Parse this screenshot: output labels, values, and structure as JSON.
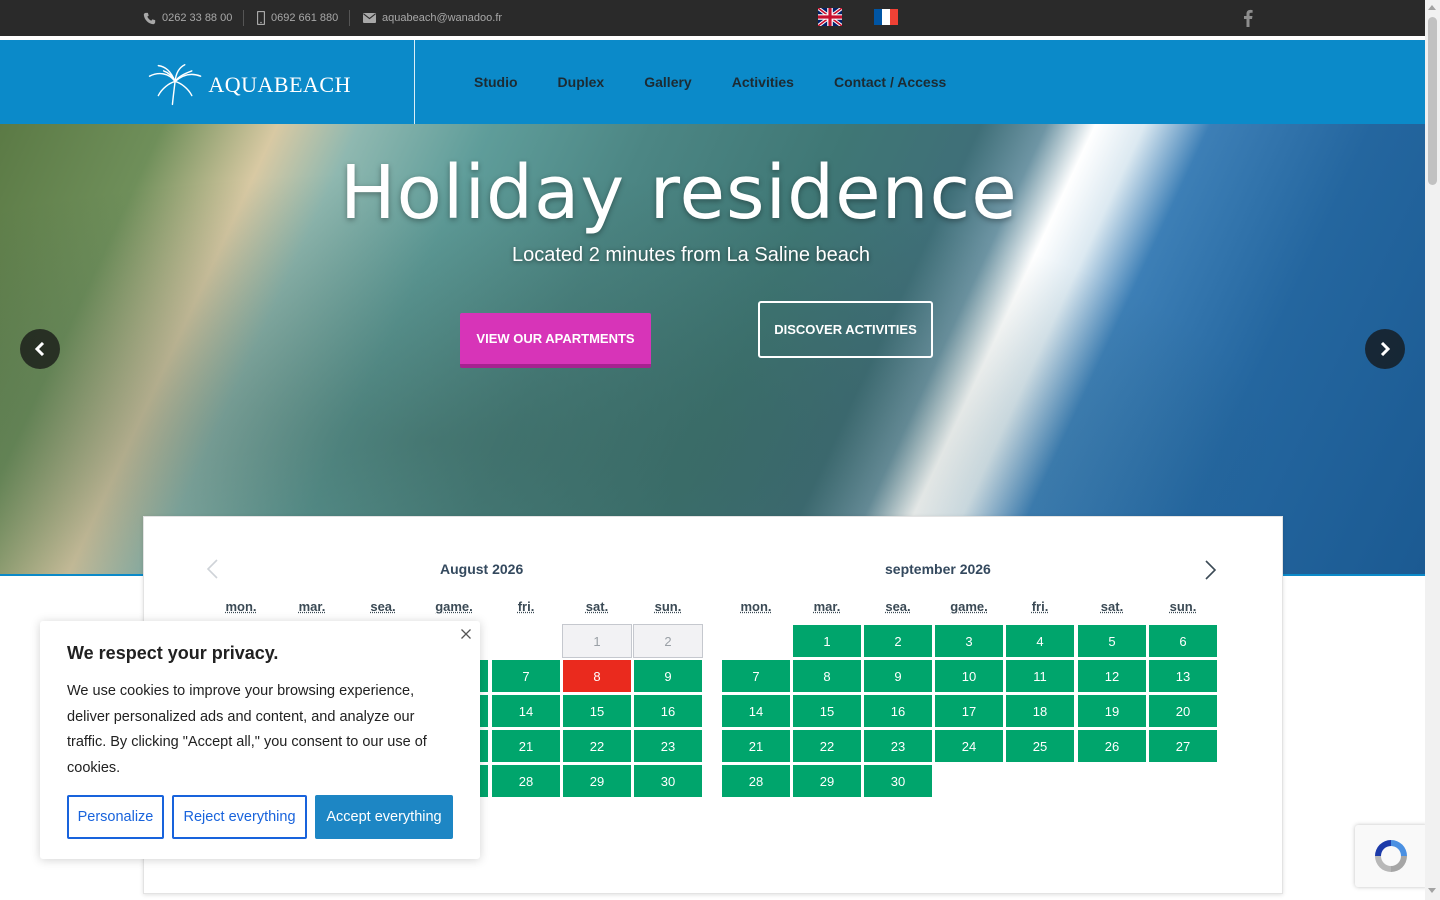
{
  "topbar": {
    "phone": "0262 33 88 00",
    "mobile": "0692 661 880",
    "email": "aquabeach@wanadoo.fr",
    "icons": [
      "phone-icon",
      "mobile-icon",
      "envelope-icon",
      "facebook-icon"
    ],
    "flags": [
      "uk-flag",
      "france-flag"
    ]
  },
  "header": {
    "logo_text": "AQUABEACH",
    "nav": [
      "Studio",
      "Duplex",
      "Gallery",
      "Activities",
      "Contact / Access"
    ]
  },
  "hero": {
    "title": "Holiday residence",
    "subtitle": "Located 2 minutes from La Saline beach",
    "btn_apartments": "VIEW OUR APARTMENTS",
    "btn_activities": "DISCOVER ACTIVITIES"
  },
  "calendar": {
    "months": [
      {
        "title": "August  2026",
        "days_of_week": [
          "mon.",
          "mar.",
          "sea.",
          "game.",
          "fri.",
          "sat.",
          "sun."
        ],
        "past_days": [
          "1",
          "2"
        ],
        "booked_days": [
          "8"
        ],
        "visible_days": [
          "7",
          "9",
          "14",
          "15",
          "16",
          "21",
          "22",
          "23",
          "28",
          "29",
          "30"
        ]
      },
      {
        "title": "september  2026",
        "days_of_week": [
          "mon.",
          "mar.",
          "sea.",
          "game.",
          "fri.",
          "sat.",
          "sun."
        ],
        "days": [
          "1",
          "2",
          "3",
          "4",
          "5",
          "6",
          "7",
          "8",
          "9",
          "10",
          "11",
          "12",
          "13",
          "14",
          "15",
          "16",
          "17",
          "18",
          "19",
          "20",
          "21",
          "22",
          "23",
          "24",
          "25",
          "26",
          "27",
          "28",
          "29",
          "30"
        ]
      }
    ]
  },
  "cookie": {
    "title": "We respect your privacy.",
    "text": "We use cookies to improve your browsing experience, deliver personalized ads and content, and analyze our traffic. By clicking \"Accept all,\" you consent to our use of cookies.",
    "personalize": "Personalize",
    "reject": "Reject everything",
    "accept": "Accept everything"
  },
  "colors": {
    "header_blue": "#0b8ac9",
    "topbar_dark": "#2a2a2a",
    "available_green": "#00a56c",
    "booked_red": "#ea2a1e",
    "apartments_pink": "#d734b8",
    "cookie_accept_blue": "#1d86c4"
  }
}
